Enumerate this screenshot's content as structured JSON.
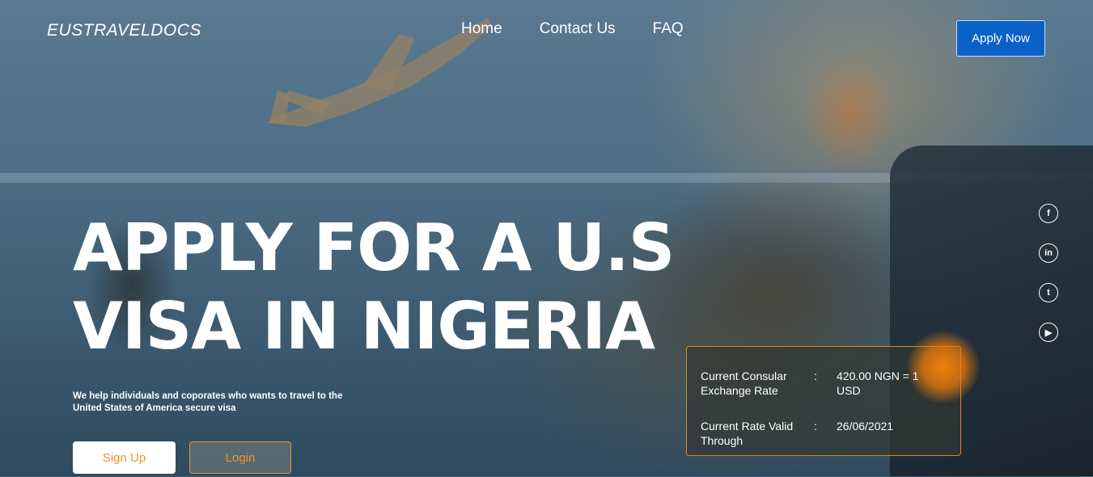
{
  "header": {
    "logo": "EUSTRAVELDOCS",
    "nav": [
      "Home",
      "Contact Us",
      "FAQ"
    ],
    "cta": "Apply Now"
  },
  "hero": {
    "headline_line1": "APPLY FOR A U.S",
    "headline_line2": "VISA IN NIGERIA",
    "subtext": "We help individuals and coporates who wants to travel to the United States of America secure visa",
    "signup": "Sign Up",
    "login": "Login"
  },
  "social": {
    "icons": [
      "facebook-icon",
      "linkedin-icon",
      "twitter-icon",
      "youtube-icon"
    ],
    "glyphs": [
      "f",
      "in",
      "t",
      "▶"
    ]
  },
  "rate_box": {
    "label1": "Current Consular Exchange Rate",
    "sep": ":",
    "value1": "420.00 NGN = 1 USD",
    "label2": "Current Rate Valid Through",
    "value2": "26/06/2021"
  },
  "colors": {
    "accent_blue": "#0a62c9",
    "accent_orange": "#f0922b"
  }
}
